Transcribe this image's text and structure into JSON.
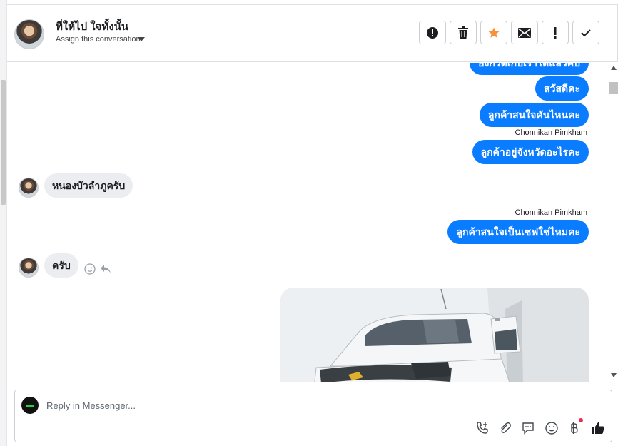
{
  "conversation": {
    "name": "ที่ให้ไป ใจทั้งนั้น",
    "assign_label": "Assign this conversation"
  },
  "header_actions": [
    {
      "name": "report-spam",
      "icon": "alert-circle-icon"
    },
    {
      "name": "delete",
      "icon": "trash-icon"
    },
    {
      "name": "star",
      "icon": "star-icon",
      "color": "#f7923a"
    },
    {
      "name": "mark-unread",
      "icon": "envelope-icon"
    },
    {
      "name": "follow-up",
      "icon": "exclamation-icon"
    },
    {
      "name": "done",
      "icon": "checkmark-icon"
    }
  ],
  "messages": [
    {
      "direction": "out",
      "text": "ยังกวดเกบเราไดแลวคบ"
    },
    {
      "direction": "out",
      "text": "สวัสดีคะ"
    },
    {
      "direction": "out",
      "text": "ลูกค้าสนใจคันไหนคะ"
    },
    {
      "direction": "out",
      "sender": "Chonnikan Pimkham",
      "text": "ลูกค้าอยู่จังหวัดอะไรคะ"
    },
    {
      "direction": "in",
      "text": "หนองบัวลำภูครับ"
    },
    {
      "direction": "out",
      "sender": "Chonnikan Pimkham",
      "text": "ลูกค้าสนใจเป็นเชฟใช่ไหมคะ"
    },
    {
      "direction": "in",
      "text": "ครับ"
    },
    {
      "direction": "out",
      "type": "image",
      "image": "white-pickup-truck-photo"
    }
  ],
  "composer": {
    "placeholder": "Reply in Messenger...",
    "tools": [
      "phone-plus-icon",
      "paperclip-icon",
      "saved-reply-icon",
      "emoji-icon",
      "baht-icon",
      "thumbs-up-icon"
    ]
  },
  "colors": {
    "outgoing_bubble": "#0a7cff",
    "incoming_bubble": "#ebedf0",
    "accent_star": "#f7923a",
    "notify_dot": "#f02849"
  }
}
